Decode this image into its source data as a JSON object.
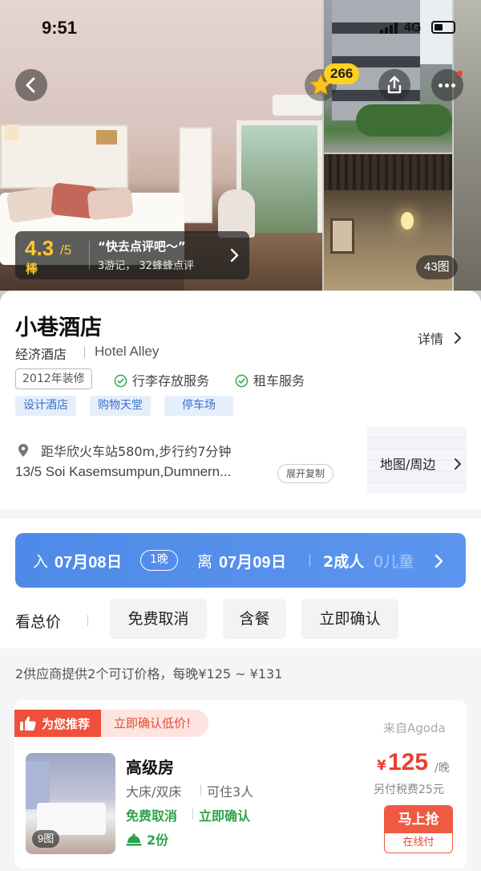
{
  "status_bar": {
    "time": "9:51",
    "network": "4G"
  },
  "hero": {
    "favorite_count": "266",
    "rating": {
      "score": "4.3",
      "max": "/5",
      "word": "棒",
      "quote": "“快去点评吧～”",
      "stats": "3游记， 32蜂蜂点评"
    },
    "photo_count": "43图"
  },
  "hotel": {
    "name": "小巷酒店",
    "type": "经济酒店",
    "english_name": "Hotel Alley",
    "detail_link": "详情",
    "renovated": "2012年装修",
    "services": [
      "行李存放服务",
      "租车服务"
    ],
    "feature_tags": [
      "设计酒店",
      "购物天堂",
      "停车场"
    ],
    "location": {
      "distance": "距华欣火车站580m,步行约7分钟",
      "address": "13/5 Soi Kasemsumpun,Dumnern...",
      "expand_button": "展开复制",
      "map_link": "地图/周边"
    }
  },
  "booking": {
    "checkin_label": "入",
    "checkin_date": "07月08",
    "checkin_suffix": "日",
    "nights": "1晚",
    "checkout_label": "离",
    "checkout_date": "07月09",
    "checkout_suffix": "日",
    "adults": "2成人",
    "children": "0儿童",
    "filters": {
      "total_price": "看总价",
      "chips": [
        "免费取消",
        "含餐",
        "立即确认"
      ]
    },
    "supplier_note": "2供应商提供2个可订价格，每晚¥125 ~ ¥131"
  },
  "room_offer": {
    "recommend_badge": "为您推荐",
    "recommend_text": "立即确认低价!",
    "source": "来自Agoda",
    "photo_count": "9图",
    "name": "高级房",
    "beds": "大床/双床",
    "occupancy": "可住3人",
    "cancel_policy": "免费取消",
    "confirm_policy": "立即确认",
    "stock": "2份",
    "currency": "¥",
    "price": "125",
    "price_unit": "/晚",
    "tax_note": "另付税费25元",
    "book_button": "马上抢",
    "pay_method": "在线付"
  },
  "colors": {
    "accent_blue": "#4f8ae8",
    "price_red": "#e8402c",
    "badge_red": "#ef4f3b",
    "rating_gold": "#ffc82e",
    "green": "#2ea24a"
  }
}
